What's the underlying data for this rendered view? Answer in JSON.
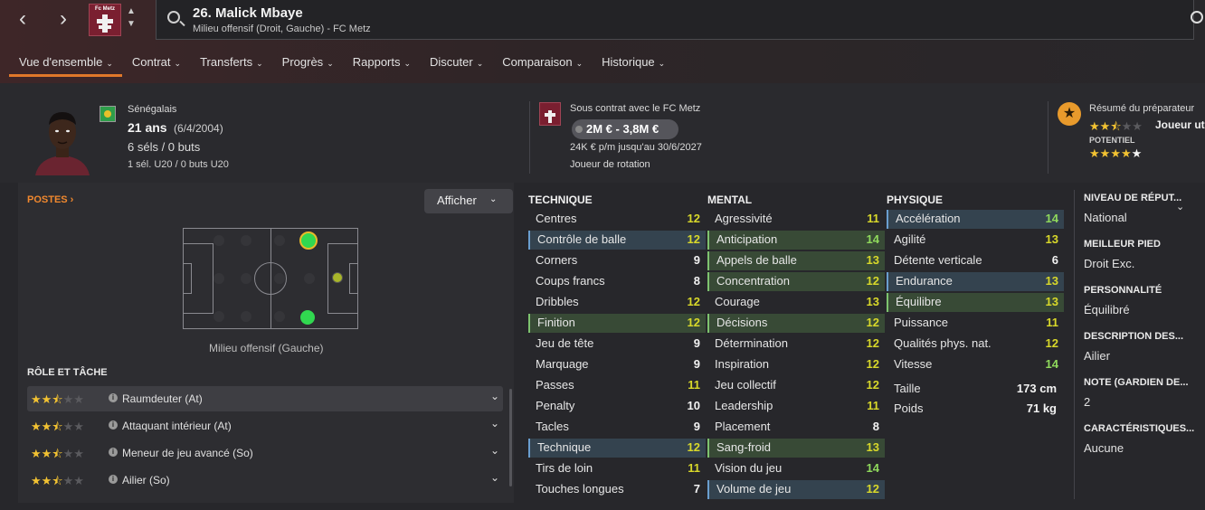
{
  "header": {
    "player_title": "26. Malick Mbaye",
    "player_subtitle": "Milieu offensif (Droit, Gauche) - FC Metz",
    "club_crest_text": "Fc Metz"
  },
  "tabs": [
    {
      "label": "Vue d'ensemble",
      "active": true
    },
    {
      "label": "Contrat"
    },
    {
      "label": "Transferts"
    },
    {
      "label": "Progrès"
    },
    {
      "label": "Rapports"
    },
    {
      "label": "Discuter"
    },
    {
      "label": "Comparaison"
    },
    {
      "label": "Historique"
    }
  ],
  "profile": {
    "nationality": "Sénégalais",
    "age": "21 ans",
    "dob": "(6/4/2004)",
    "caps": "6 séls / 0 buts",
    "youth_caps": "1 sél. U20 / 0 buts U20"
  },
  "contract": {
    "label": "Sous contrat avec le FC Metz",
    "value_range": "2M € - 3,8M €",
    "wage": "24K € p/m jusqu'au 30/6/2027",
    "status": "Joueur de rotation"
  },
  "report": {
    "title": "Résumé du préparateur",
    "summary": "Joueur ut",
    "ability_stars": 2.5,
    "potential_label": "POTENTIEL",
    "potential_stars": 4.5
  },
  "positions": {
    "title": "POSTES",
    "show_button": "Afficher",
    "caption": "Milieu offensif (Gauche)"
  },
  "roles": {
    "title": "RÔLE ET TÂCHE",
    "items": [
      {
        "label": "Raumdeuter (At)",
        "stars": 2.5
      },
      {
        "label": "Attaquant intérieur (At)",
        "stars": 2.5
      },
      {
        "label": "Meneur de jeu avancé (So)",
        "stars": 2.5
      },
      {
        "label": "Ailier (So)",
        "stars": 2.5
      }
    ]
  },
  "attributes": {
    "technique": {
      "title": "TECHNIQUE",
      "items": [
        {
          "name": "Centres",
          "value": "12",
          "hl": ""
        },
        {
          "name": "Contrôle de balle",
          "value": "12",
          "hl": "blue"
        },
        {
          "name": "Corners",
          "value": "9",
          "hl": ""
        },
        {
          "name": "Coups francs",
          "value": "8",
          "hl": ""
        },
        {
          "name": "Dribbles",
          "value": "12",
          "hl": ""
        },
        {
          "name": "Finition",
          "value": "12",
          "hl": "green"
        },
        {
          "name": "Jeu de tête",
          "value": "9",
          "hl": ""
        },
        {
          "name": "Marquage",
          "value": "9",
          "hl": ""
        },
        {
          "name": "Passes",
          "value": "11",
          "hl": ""
        },
        {
          "name": "Penalty",
          "value": "10",
          "hl": ""
        },
        {
          "name": "Tacles",
          "value": "9",
          "hl": ""
        },
        {
          "name": "Technique",
          "value": "12",
          "hl": "blue"
        },
        {
          "name": "Tirs de loin",
          "value": "11",
          "hl": ""
        },
        {
          "name": "Touches longues",
          "value": "7",
          "hl": ""
        }
      ]
    },
    "mental": {
      "title": "MENTAL",
      "items": [
        {
          "name": "Agressivité",
          "value": "11",
          "hl": ""
        },
        {
          "name": "Anticipation",
          "value": "14",
          "hl": "green"
        },
        {
          "name": "Appels de balle",
          "value": "13",
          "hl": "green"
        },
        {
          "name": "Concentration",
          "value": "12",
          "hl": "green"
        },
        {
          "name": "Courage",
          "value": "13",
          "hl": ""
        },
        {
          "name": "Décisions",
          "value": "12",
          "hl": "green"
        },
        {
          "name": "Détermination",
          "value": "12",
          "hl": ""
        },
        {
          "name": "Inspiration",
          "value": "12",
          "hl": ""
        },
        {
          "name": "Jeu collectif",
          "value": "12",
          "hl": ""
        },
        {
          "name": "Leadership",
          "value": "11",
          "hl": ""
        },
        {
          "name": "Placement",
          "value": "8",
          "hl": ""
        },
        {
          "name": "Sang-froid",
          "value": "13",
          "hl": "green"
        },
        {
          "name": "Vision du jeu",
          "value": "14",
          "hl": ""
        },
        {
          "name": "Volume de jeu",
          "value": "12",
          "hl": "blue"
        }
      ]
    },
    "physique": {
      "title": "PHYSIQUE",
      "items": [
        {
          "name": "Accélération",
          "value": "14",
          "hl": "blue"
        },
        {
          "name": "Agilité",
          "value": "13",
          "hl": ""
        },
        {
          "name": "Détente verticale",
          "value": "6",
          "hl": ""
        },
        {
          "name": "Endurance",
          "value": "13",
          "hl": "blue"
        },
        {
          "name": "Équilibre",
          "value": "13",
          "hl": "green"
        },
        {
          "name": "Puissance",
          "value": "11",
          "hl": ""
        },
        {
          "name": "Qualités phys. nat.",
          "value": "12",
          "hl": ""
        },
        {
          "name": "Vitesse",
          "value": "14",
          "hl": ""
        }
      ],
      "height_label": "Taille",
      "height_value": "173 cm",
      "weight_label": "Poids",
      "weight_value": "71 kg"
    }
  },
  "info": [
    {
      "title": "NIVEAU DE RÉPUT...",
      "value": "National"
    },
    {
      "title": "MEILLEUR PIED",
      "value": "Droit Exc."
    },
    {
      "title": "PERSONNALITÉ",
      "value": "Équilibré"
    },
    {
      "title": "DESCRIPTION DES...",
      "value": "Ailier"
    },
    {
      "title": "NOTE (GARDIEN DE...",
      "value": "2"
    },
    {
      "title": "CARACTÉRISTIQUES...",
      "value": "Aucune"
    }
  ]
}
